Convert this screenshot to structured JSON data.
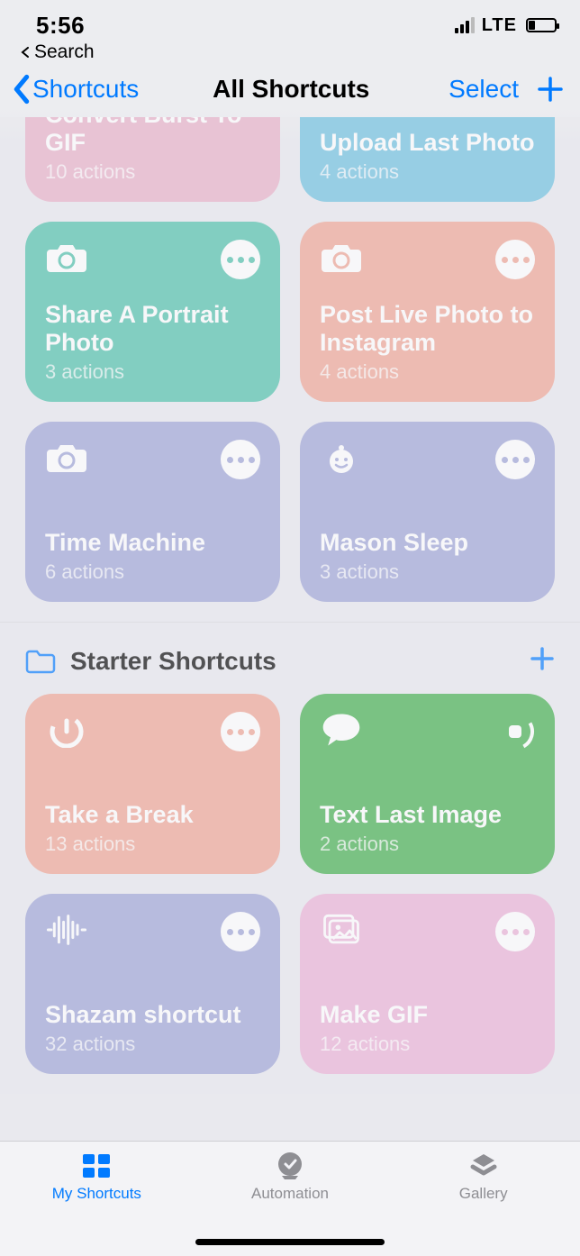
{
  "status": {
    "time": "5:56",
    "carrier": "LTE"
  },
  "breadcrumb": {
    "back_app": "Search"
  },
  "nav": {
    "back_label": "Shortcuts",
    "title": "All Shortcuts",
    "select_label": "Select"
  },
  "sections": [
    {
      "id": "main",
      "cards": [
        {
          "title": "Convert Burst To GIF",
          "sub": "10 actions",
          "color": "c-pink",
          "icon": "camera",
          "dots": "#e9b0c7"
        },
        {
          "title": "Upload Last Photo",
          "sub": "4 actions",
          "color": "c-blue",
          "icon": "camera",
          "dots": "#6cc0df",
          "single": true
        },
        {
          "title": "Share A Portrait Photo",
          "sub": "3 actions",
          "color": "c-teal",
          "icon": "camera",
          "dots": "#4cc0a9"
        },
        {
          "title": "Post Live Photo to Instagram",
          "sub": "4 actions",
          "color": "c-salmon",
          "icon": "camera",
          "dots": "#f0a493"
        },
        {
          "title": "Time Machine",
          "sub": "6 actions",
          "color": "c-slate",
          "icon": "camera",
          "dots": "#9da3d6"
        },
        {
          "title": "Mason Sleep",
          "sub": "3 actions",
          "color": "c-slate",
          "icon": "baby",
          "dots": "#9da3d6"
        }
      ]
    },
    {
      "id": "starter",
      "title": "Starter Shortcuts",
      "cards": [
        {
          "title": "Take a Break",
          "sub": "13 actions",
          "color": "c-salmon",
          "icon": "timer",
          "dots": "#f0a493"
        },
        {
          "title": "Text Last Image",
          "sub": "2 actions",
          "color": "c-green",
          "icon": "chatplus",
          "running": true
        },
        {
          "title": "Shazam shortcut",
          "sub": "32 actions",
          "color": "c-slate",
          "icon": "wave",
          "dots": "#9da3d6"
        },
        {
          "title": "Make GIF",
          "sub": "12 actions",
          "color": "c-pink2",
          "icon": "photos",
          "dots": "#ecb1d6"
        }
      ]
    }
  ],
  "tabs": {
    "my_shortcuts": "My Shortcuts",
    "automation": "Automation",
    "gallery": "Gallery"
  }
}
